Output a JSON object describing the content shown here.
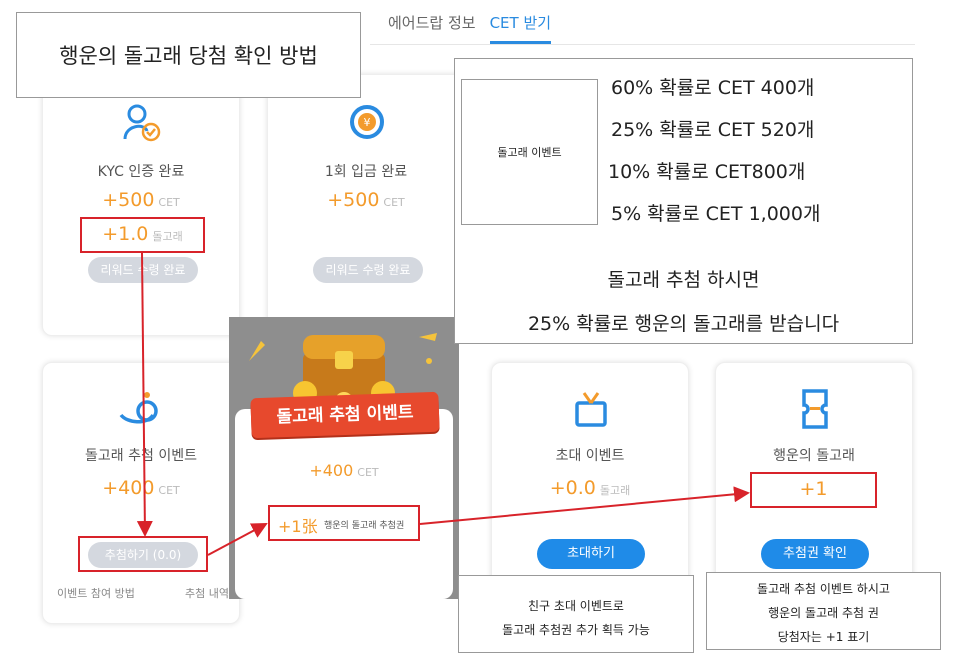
{
  "tabs": [
    "에어드랍 정보",
    "CET 받기"
  ],
  "title_note": "행운의 돌고래 당첨 확인 방법",
  "cards": {
    "kyc": {
      "title": "KYC 인증 완료",
      "cet": "+500",
      "cet_unit": "CET",
      "dolphin": "+1.0",
      "dolphin_unit": "돌고래",
      "button": "리워드 수령 완료"
    },
    "deposit": {
      "title": "1회 입금 완료",
      "cet": "+500",
      "cet_unit": "CET",
      "button": "리워드 수령 완료"
    },
    "draw": {
      "title": "돌고래 추첨 이벤트",
      "cet": "+400",
      "cet_unit": "CET",
      "button": "추첨하기 (0.0)",
      "link_left": "이벤트 참여 방법",
      "link_right": "추첨 내역"
    },
    "popup": {
      "banner": "돌고래 추첨 이벤트",
      "cet": "+400",
      "cet_unit": "CET",
      "ticket": "+1张",
      "ticket_label": "행운의 돌고래 추첨권"
    },
    "invite": {
      "title": "초대 이벤트",
      "cet": "+0.0",
      "cet_unit": "돌고래",
      "button": "초대하기"
    },
    "lucky": {
      "title": "행운의 돌고래",
      "value": "+1",
      "button": "추첨권 확인"
    }
  },
  "event_note": {
    "box_label": "돌고래 이벤트",
    "odds": [
      "60% 확률로 CET 400개",
      "25% 확률로 CET 520개",
      "10% 확률로 CET800개",
      "5% 확률로 CET 1,000개"
    ],
    "line1": "돌고래 추첨 하시면",
    "line2": "25% 확률로 행운의 돌고래를 받습니다"
  },
  "invite_note": [
    "친구 초대 이벤트로",
    "돌고래 추첨권 추가 획득 가능"
  ],
  "lucky_note": [
    "돌고래 추첨 이벤트 하시고",
    "행운의 돌고래 추첨 권",
    "당첨자는 +1 표기"
  ],
  "colors": {
    "accent": "#2a8be0",
    "orange": "#f39b2c",
    "red": "#d8232a"
  }
}
